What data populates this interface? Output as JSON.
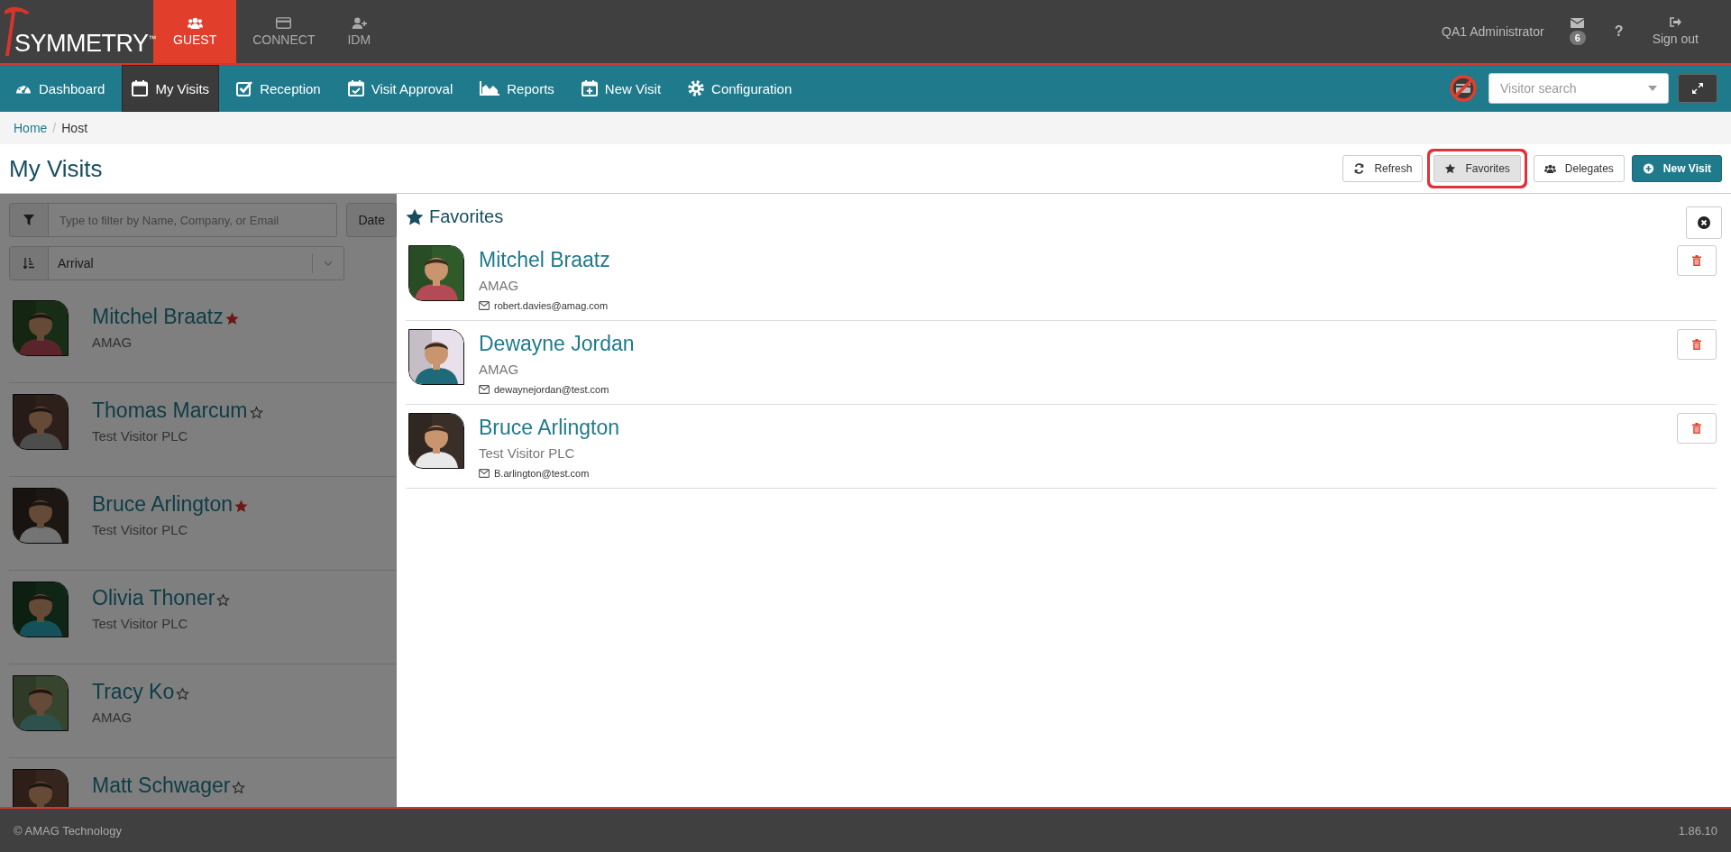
{
  "top_bar": {
    "logo": {
      "text": "SYMMETRY",
      "mark": "™"
    },
    "apps": [
      {
        "label": "GUEST",
        "selected": true
      },
      {
        "label": "CONNECT",
        "selected": false
      },
      {
        "label": "IDM",
        "selected": false
      }
    ],
    "user": "QA1 Administrator",
    "messages_count": "6",
    "help": "?",
    "sign_out": "Sign out"
  },
  "nav": {
    "items": [
      {
        "label": "Dashboard",
        "selected": false
      },
      {
        "label": "My Visits",
        "selected": true
      },
      {
        "label": "Reception",
        "selected": false
      },
      {
        "label": "Visit Approval",
        "selected": false
      },
      {
        "label": "Reports",
        "selected": false
      },
      {
        "label": "New Visit",
        "selected": false
      },
      {
        "label": "Configuration",
        "selected": false
      }
    ],
    "visitor_search": {
      "placeholder": "Visitor search"
    }
  },
  "breadcrumb": {
    "items": [
      "Home",
      "Host"
    ],
    "separator": "/"
  },
  "page_title": "My Visits",
  "toolbar": [
    {
      "label": "Refresh",
      "kind": "default",
      "selected": false
    },
    {
      "label": "Favorites",
      "kind": "default",
      "selected": true
    },
    {
      "label": "Delegates",
      "kind": "default",
      "selected": false
    },
    {
      "label": "New Visit",
      "kind": "primary",
      "selected": false
    }
  ],
  "visits": {
    "filter": {
      "placeholder": "Type to filter by Name, Company, or Email"
    },
    "date_button": "Date",
    "sort": "Arrival",
    "rows": [
      {
        "name": "Mitchel Braatz",
        "company": "AMAG",
        "favorite": true
      },
      {
        "name": "Thomas Marcum",
        "company": "Test Visitor PLC",
        "favorite": false
      },
      {
        "name": "Bruce Arlington",
        "company": "Test Visitor PLC",
        "favorite": true
      },
      {
        "name": "Olivia Thoner",
        "company": "Test Visitor PLC",
        "favorite": false
      },
      {
        "name": "Tracy Ko",
        "company": "AMAG",
        "favorite": false
      },
      {
        "name": "Matt Schwager",
        "favorite": false
      }
    ]
  },
  "favorites_panel": {
    "title": "Favorites",
    "rows": [
      {
        "name": "Mitchel Braatz",
        "company": "AMAG",
        "email": "robert.davies@amag.com"
      },
      {
        "name": "Dewayne Jordan",
        "company": "AMAG",
        "email": "dewaynejordan@test.com"
      },
      {
        "name": "Bruce Arlington",
        "company": "Test Visitor PLC",
        "email": "B.arlington@test.com"
      }
    ]
  },
  "footer": {
    "copyright": "© AMAG Technology",
    "version": "1.86.10"
  }
}
